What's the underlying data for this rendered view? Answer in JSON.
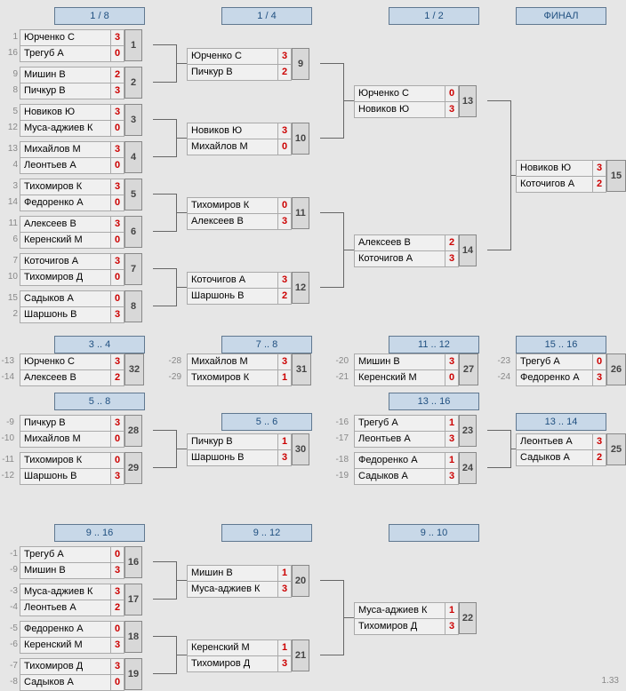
{
  "version": "1.33",
  "headers": {
    "r1": "1 / 8",
    "r2": "1 / 4",
    "r3": "1 / 2",
    "r4": "ФИНАЛ",
    "p34": "3 .. 4",
    "p58": "5 .. 8",
    "p916": "9 .. 16",
    "p78": "7 .. 8",
    "p56": "5 .. 6",
    "p912": "9 .. 12",
    "p1112": "11 .. 12",
    "p1316": "13 .. 16",
    "p910": "9 .. 10",
    "p1516": "15 .. 16",
    "p1314": "13 .. 14"
  },
  "m": {
    "1": {
      "s": [
        "1",
        "16"
      ],
      "p": [
        "Юрченко С",
        "Трегуб А"
      ],
      "sc": [
        "3",
        "0"
      ],
      "id": "1"
    },
    "2": {
      "s": [
        "9",
        "8"
      ],
      "p": [
        "Мишин В",
        "Пичкур В"
      ],
      "sc": [
        "2",
        "3"
      ],
      "id": "2"
    },
    "3": {
      "s": [
        "5",
        "12"
      ],
      "p": [
        "Новиков Ю",
        "Муса-аджиев К"
      ],
      "sc": [
        "3",
        "0"
      ],
      "id": "3"
    },
    "4": {
      "s": [
        "13",
        "4"
      ],
      "p": [
        "Михайлов М",
        "Леонтьев А"
      ],
      "sc": [
        "3",
        "0"
      ],
      "id": "4"
    },
    "5": {
      "s": [
        "3",
        "14"
      ],
      "p": [
        "Тихомиров К",
        "Федоренко А"
      ],
      "sc": [
        "3",
        "0"
      ],
      "id": "5"
    },
    "6": {
      "s": [
        "11",
        "6"
      ],
      "p": [
        "Алексеев В",
        "Керенский М"
      ],
      "sc": [
        "3",
        "0"
      ],
      "id": "6"
    },
    "7": {
      "s": [
        "7",
        "10"
      ],
      "p": [
        "Коточигов А",
        "Тихомиров Д"
      ],
      "sc": [
        "3",
        "0"
      ],
      "id": "7"
    },
    "8": {
      "s": [
        "15",
        "2"
      ],
      "p": [
        "Садыков А",
        "Шаршонь В"
      ],
      "sc": [
        "0",
        "3"
      ],
      "id": "8"
    },
    "9": {
      "p": [
        "Юрченко С",
        "Пичкур В"
      ],
      "sc": [
        "3",
        "2"
      ],
      "id": "9"
    },
    "10": {
      "p": [
        "Новиков Ю",
        "Михайлов М"
      ],
      "sc": [
        "3",
        "0"
      ],
      "id": "10"
    },
    "11": {
      "p": [
        "Тихомиров К",
        "Алексеев В"
      ],
      "sc": [
        "0",
        "3"
      ],
      "id": "11"
    },
    "12": {
      "p": [
        "Коточигов А",
        "Шаршонь В"
      ],
      "sc": [
        "3",
        "2"
      ],
      "id": "12"
    },
    "13": {
      "p": [
        "Юрченко С",
        "Новиков Ю"
      ],
      "sc": [
        "0",
        "3"
      ],
      "id": "13"
    },
    "14": {
      "p": [
        "Алексеев В",
        "Коточигов А"
      ],
      "sc": [
        "2",
        "3"
      ],
      "id": "14"
    },
    "15": {
      "p": [
        "Новиков Ю",
        "Коточигов А"
      ],
      "sc": [
        "3",
        "2"
      ],
      "id": "15"
    },
    "16": {
      "s": [
        "-1",
        "-9"
      ],
      "p": [
        "Трегуб А",
        "Мишин В"
      ],
      "sc": [
        "0",
        "3"
      ],
      "id": "16"
    },
    "17": {
      "s": [
        "-3",
        "-4"
      ],
      "p": [
        "Муса-аджиев К",
        "Леонтьев А"
      ],
      "sc": [
        "3",
        "2"
      ],
      "id": "17"
    },
    "18": {
      "s": [
        "-5",
        "-6"
      ],
      "p": [
        "Федоренко А",
        "Керенский М"
      ],
      "sc": [
        "0",
        "3"
      ],
      "id": "18"
    },
    "19": {
      "s": [
        "-7",
        "-8"
      ],
      "p": [
        "Тихомиров Д",
        "Садыков А"
      ],
      "sc": [
        "3",
        "0"
      ],
      "id": "19"
    },
    "20": {
      "p": [
        "Мишин В",
        "Муса-аджиев К"
      ],
      "sc": [
        "1",
        "3"
      ],
      "id": "20"
    },
    "21": {
      "p": [
        "Керенский М",
        "Тихомиров Д"
      ],
      "sc": [
        "1",
        "3"
      ],
      "id": "21"
    },
    "22": {
      "p": [
        "Муса-аджиев К",
        "Тихомиров Д"
      ],
      "sc": [
        "1",
        "3"
      ],
      "id": "22"
    },
    "23": {
      "s": [
        "-16",
        "-17"
      ],
      "p": [
        "Трегуб А",
        "Леонтьев А"
      ],
      "sc": [
        "1",
        "3"
      ],
      "id": "23"
    },
    "24": {
      "s": [
        "-18",
        "-19"
      ],
      "p": [
        "Федоренко А",
        "Садыков А"
      ],
      "sc": [
        "1",
        "3"
      ],
      "id": "24"
    },
    "25": {
      "p": [
        "Леонтьев А",
        "Садыков А"
      ],
      "sc": [
        "3",
        "2"
      ],
      "id": "25"
    },
    "26": {
      "s": [
        "-23",
        "-24"
      ],
      "p": [
        "Трегуб А",
        "Федоренко А"
      ],
      "sc": [
        "0",
        "3"
      ],
      "id": "26"
    },
    "27": {
      "s": [
        "-20",
        "-21"
      ],
      "p": [
        "Мишин В",
        "Керенский М"
      ],
      "sc": [
        "3",
        "0"
      ],
      "id": "27"
    },
    "28": {
      "s": [
        "-9",
        "-10"
      ],
      "p": [
        "Пичкур В",
        "Михайлов М"
      ],
      "sc": [
        "3",
        "0"
      ],
      "id": "28"
    },
    "29": {
      "s": [
        "-11",
        "-12"
      ],
      "p": [
        "Тихомиров К",
        "Шаршонь В"
      ],
      "sc": [
        "0",
        "3"
      ],
      "id": "29"
    },
    "30": {
      "p": [
        "Пичкур В",
        "Шаршонь В"
      ],
      "sc": [
        "1",
        "3"
      ],
      "id": "30"
    },
    "31": {
      "s": [
        "-28",
        "-29"
      ],
      "p": [
        "Михайлов М",
        "Тихомиров К"
      ],
      "sc": [
        "3",
        "1"
      ],
      "id": "31"
    },
    "32": {
      "s": [
        "-13",
        "-14"
      ],
      "p": [
        "Юрченко С",
        "Алексеев В"
      ],
      "sc": [
        "3",
        "2"
      ],
      "id": "32"
    }
  }
}
